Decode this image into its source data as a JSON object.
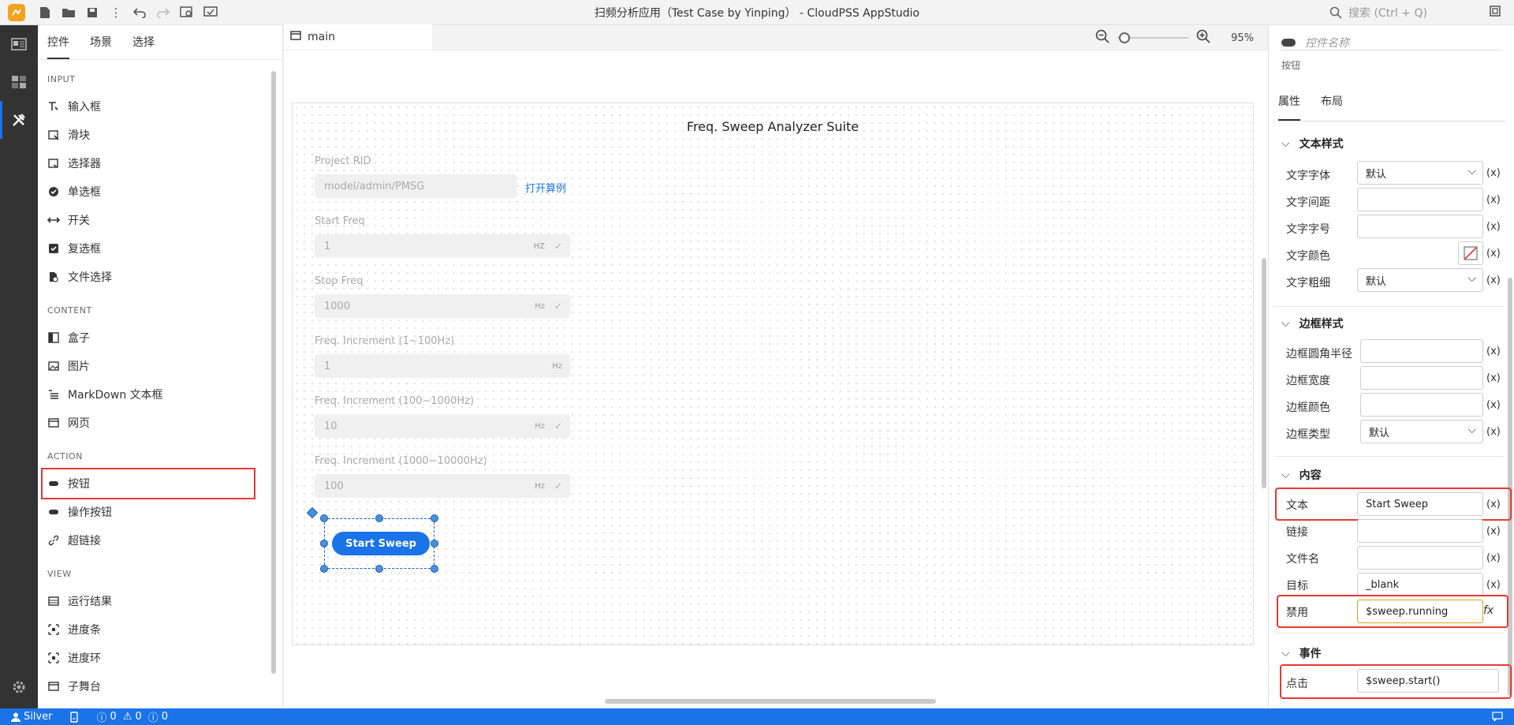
{
  "window": {
    "title": "扫频分析应用（Test Case by Yinping） - CloudPSS AppStudio",
    "search_placeholder": "搜索 (Ctrl + Q)"
  },
  "sidebar": {
    "tabs": [
      "控件",
      "场景",
      "选择"
    ],
    "sections": [
      {
        "title": "INPUT",
        "items": [
          {
            "label": "输入框",
            "icon": "text-input-icon"
          },
          {
            "label": "滑块",
            "icon": "slider-icon"
          },
          {
            "label": "选择器",
            "icon": "select-icon"
          },
          {
            "label": "单选框",
            "icon": "radio-icon"
          },
          {
            "label": "开关",
            "icon": "switch-icon"
          },
          {
            "label": "复选框",
            "icon": "checkbox-icon"
          },
          {
            "label": "文件选择",
            "icon": "file-select-icon"
          }
        ]
      },
      {
        "title": "CONTENT",
        "items": [
          {
            "label": "盒子",
            "icon": "box-icon"
          },
          {
            "label": "图片",
            "icon": "image-icon"
          },
          {
            "label": "MarkDown 文本框",
            "icon": "markdown-icon"
          },
          {
            "label": "网页",
            "icon": "webpage-icon"
          }
        ]
      },
      {
        "title": "ACTION",
        "items": [
          {
            "label": "按钮",
            "icon": "button-icon"
          },
          {
            "label": "操作按钮",
            "icon": "action-button-icon"
          },
          {
            "label": "超链接",
            "icon": "link-icon"
          }
        ]
      },
      {
        "title": "VIEW",
        "items": [
          {
            "label": "运行结果",
            "icon": "result-icon"
          },
          {
            "label": "进度条",
            "icon": "progress-bar-icon"
          },
          {
            "label": "进度环",
            "icon": "progress-ring-icon"
          },
          {
            "label": "子舞台",
            "icon": "sub-stage-icon"
          }
        ]
      }
    ]
  },
  "editor": {
    "tab": "main",
    "zoom": "95%",
    "canvas": {
      "title": "Freq. Sweep Analyzer Suite",
      "project_rid_label": "Project RID",
      "project_rid_value": "model/admin/PMSG",
      "open_case_link": "打开算例",
      "fields": [
        {
          "label": "Start Freq",
          "value": "1",
          "unit": "HZ",
          "check": true
        },
        {
          "label": "Stop Freq",
          "value": "1000",
          "unit": "Hz",
          "check": true
        },
        {
          "label": "Freq. Increment (1~100Hz)",
          "value": "1",
          "unit": "Hz",
          "check": false
        },
        {
          "label": "Freq. Increment (100~1000Hz)",
          "value": "10",
          "unit": "Hz",
          "check": true
        },
        {
          "label": "Freq. Increment (1000~10000Hz)",
          "value": "100",
          "unit": "Hz",
          "check": true
        }
      ],
      "button_label": "Start Sweep"
    }
  },
  "properties": {
    "name_placeholder": "控件名称",
    "type": "按钮",
    "tabs": [
      "属性",
      "布局"
    ],
    "groups": {
      "text_style": {
        "title": "文本样式",
        "rows": [
          {
            "label": "文字字体",
            "value": "默认"
          },
          {
            "label": "文字间距",
            "value": ""
          },
          {
            "label": "文字字号",
            "value": ""
          },
          {
            "label": "文字颜色",
            "value": ""
          },
          {
            "label": "文字粗细",
            "value": "默认"
          }
        ]
      },
      "border_style": {
        "title": "边框样式",
        "rows": [
          {
            "label": "边框圆角半径",
            "value": ""
          },
          {
            "label": "边框宽度",
            "value": ""
          },
          {
            "label": "边框颜色",
            "value": ""
          },
          {
            "label": "边框类型",
            "value": "默认"
          }
        ]
      },
      "content": {
        "title": "内容",
        "rows": [
          {
            "label": "文本",
            "value": "Start Sweep"
          },
          {
            "label": "链接",
            "value": ""
          },
          {
            "label": "文件名",
            "value": ""
          },
          {
            "label": "目标",
            "value": "_blank"
          },
          {
            "label": "禁用",
            "value": "$sweep.running"
          }
        ]
      },
      "events": {
        "title": "事件",
        "rows": [
          {
            "label": "点击",
            "value": "$sweep.start()"
          }
        ]
      }
    },
    "var_label": "(x)",
    "fx_label": "fx"
  },
  "statusbar": {
    "user": "Silver",
    "errors": "0",
    "warnings": "0",
    "infos": "0"
  },
  "colors": {
    "accent": "#1a73e8",
    "highlight": "#e53935",
    "logo": "#f3a21b"
  }
}
